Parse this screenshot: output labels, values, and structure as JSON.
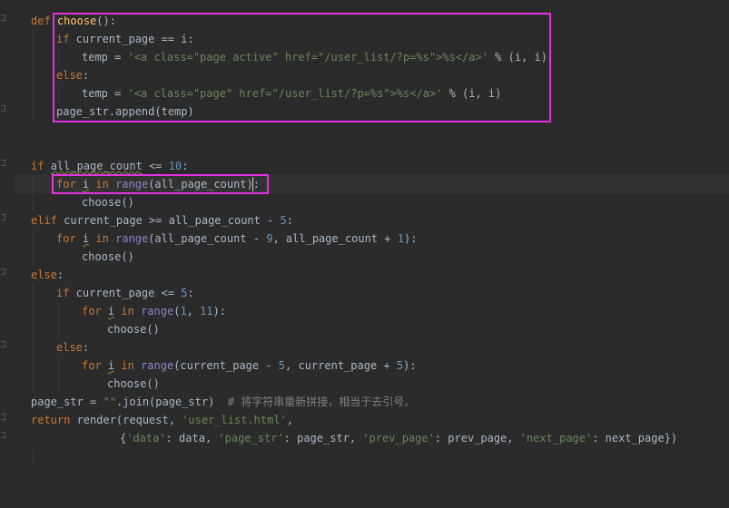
{
  "code": {
    "l1": {
      "kw": "def",
      "fn": "choose",
      "rest": "():"
    },
    "l2": {
      "kw": "if",
      "rest": " current_page == i:"
    },
    "l3": {
      "pre": "temp = ",
      "str": "'<a class=\"page active\" href=\"/user_list/?p=%s\">%s</a>'",
      "post": " % (i, i)"
    },
    "l4": {
      "kw": "else",
      "rest": ":"
    },
    "l5": {
      "pre": "temp = ",
      "str": "'<a class=\"page\" href=\"/user_list/?p=%s\">%s</a>'",
      "post": " % (i, i)"
    },
    "l6": {
      "text": "page_str.append(temp)"
    },
    "l7": {
      "kw": "if",
      "var": "all_page_count",
      "op": " <= ",
      "num": "10",
      "end": ":"
    },
    "l8": {
      "kw1": "for",
      "var": "i",
      "kw2": "in",
      "bi": "range",
      "rest": "(all_page_count):"
    },
    "l9": {
      "text": "choose()"
    },
    "l10": {
      "kw": "elif",
      "rest": " current_page >= all_page_count - ",
      "num": "5",
      "end": ":"
    },
    "l11": {
      "kw1": "for",
      "var": "i",
      "kw2": "in",
      "bi": "range",
      "a": "(all_page_count - ",
      "n1": "9",
      "b": ", all_page_count + ",
      "n2": "1",
      "c": "):"
    },
    "l12": {
      "text": "choose()"
    },
    "l13": {
      "kw": "else",
      "rest": ":"
    },
    "l14": {
      "kw": "if",
      "rest": " current_page <= ",
      "num": "5",
      "end": ":"
    },
    "l15": {
      "kw1": "for",
      "var": "i",
      "kw2": "in",
      "bi": "range",
      "a": "(",
      "n1": "1",
      "b": ", ",
      "n2": "11",
      "c": "):"
    },
    "l16": {
      "text": "choose()"
    },
    "l17": {
      "kw": "else",
      "rest": ":"
    },
    "l18": {
      "kw1": "for",
      "var": "i",
      "kw2": "in",
      "bi": "range",
      "a": "(current_page - ",
      "n1": "5",
      "b": ", current_page + ",
      "n2": "5",
      "c": "):"
    },
    "l19": {
      "text": "choose()"
    },
    "l20": {
      "pre": "page_str = ",
      "str": "\"\"",
      "mid": ".join(page_str)  ",
      "cmt": "# 将字符串重新拼接，相当于去引号。"
    },
    "l21": {
      "kw": "return",
      "a": " render(request, ",
      "str": "'user_list.html'",
      "b": ","
    },
    "l22": {
      "a": "{",
      "s1": "'data'",
      "b": ": data, ",
      "s2": "'page_str'",
      "c": ": page_str, ",
      "s3": "'prev_page'",
      "d": ": prev_page, ",
      "s4": "'next_page'",
      "e": ": next_page})"
    }
  },
  "colors": {
    "background": "#2b2b2b",
    "keyword": "#cc7832",
    "function": "#ffc66d",
    "string": "#6a8759",
    "number": "#6897bb",
    "builtin": "#8888c6",
    "comment": "#808080",
    "highlight_box": "#e332e3"
  }
}
